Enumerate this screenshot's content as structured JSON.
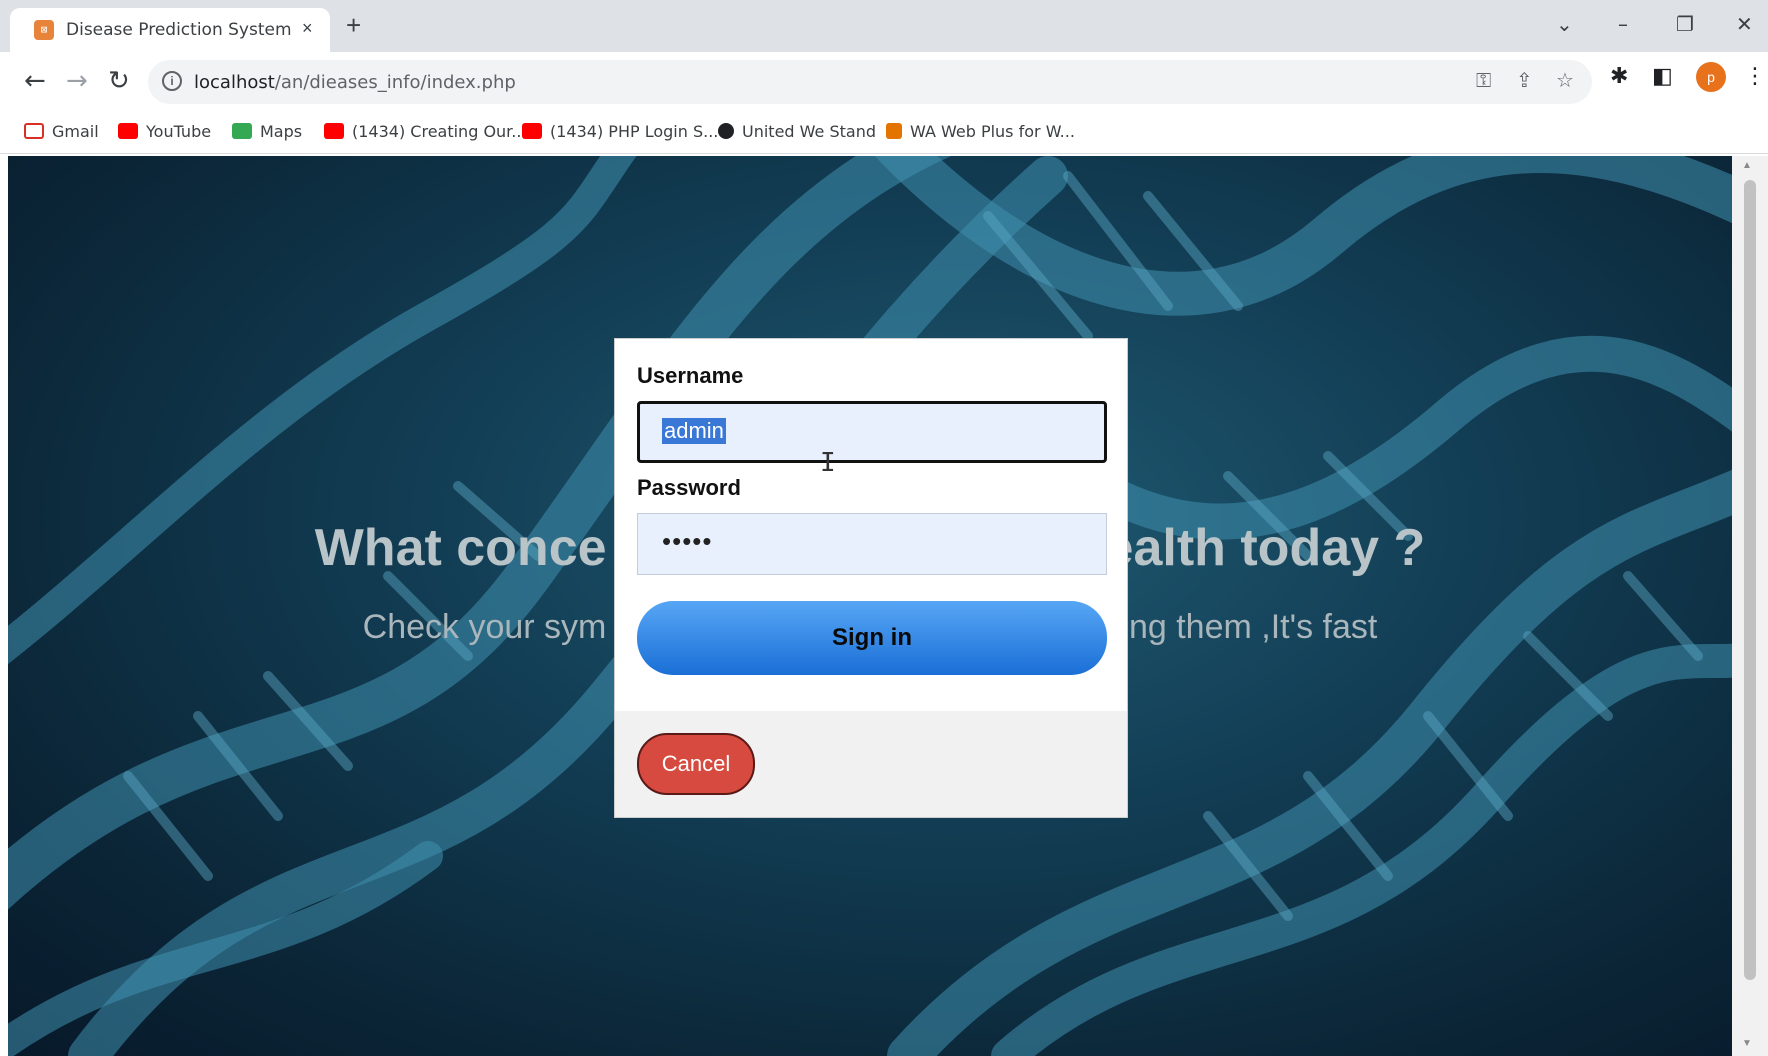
{
  "browser": {
    "tab_title": "Disease Prediction System",
    "tab_close": "×",
    "new_tab": "+",
    "url_host": "localhost",
    "url_path": "/an/dieases_info/index.php",
    "profile_initial": "p",
    "bookmarks": [
      {
        "label": "Gmail",
        "icon": "gmail-icon",
        "color": "#d93025"
      },
      {
        "label": "YouTube",
        "icon": "youtube-icon",
        "color": "#ff0000"
      },
      {
        "label": "Maps",
        "icon": "maps-icon",
        "color": "#34a853"
      },
      {
        "label": "(1434) Creating Our...",
        "icon": "youtube-icon",
        "color": "#ff0000"
      },
      {
        "label": "(1434) PHP Login S...",
        "icon": "youtube-icon",
        "color": "#ff0000"
      },
      {
        "label": "United We Stand",
        "icon": "globe-icon",
        "color": "#202124"
      },
      {
        "label": "WA Web Plus for W...",
        "icon": "extension-icon",
        "color": "#e37400"
      }
    ]
  },
  "page": {
    "hero_left": "What conce",
    "hero_right": "ealth today ?",
    "sub_left": "Check your sym",
    "sub_right": "sing them ,It's fast"
  },
  "login": {
    "username_label": "Username",
    "username_value": "admin",
    "password_label": "Password",
    "password_mask": "•••••",
    "signin_label": "Sign in",
    "cancel_label": "Cancel"
  },
  "colors": {
    "signin_button": "#2f86e6",
    "cancel_button": "#d64a3f",
    "input_background": "#e8f0fe"
  }
}
